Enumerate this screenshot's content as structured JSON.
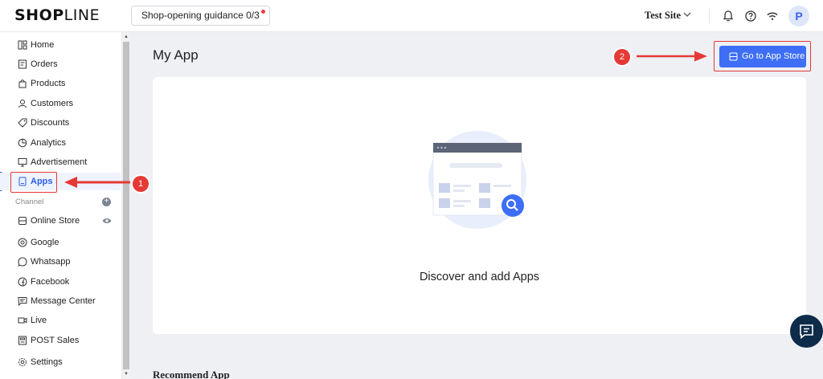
{
  "header": {
    "logo_bold": "SHOP",
    "logo_rest": "LINE",
    "guidance": "Shop-opening guidance 0/3",
    "site_name": "Test Site",
    "avatar_initial": "P"
  },
  "sidebar": {
    "items": [
      {
        "label": "Home",
        "icon": "home-icon"
      },
      {
        "label": "Orders",
        "icon": "orders-icon"
      },
      {
        "label": "Products",
        "icon": "products-icon"
      },
      {
        "label": "Customers",
        "icon": "customers-icon"
      },
      {
        "label": "Discounts",
        "icon": "discount-tag-icon"
      },
      {
        "label": "Analytics",
        "icon": "analytics-icon"
      },
      {
        "label": "Advertisement",
        "icon": "advertisement-icon"
      },
      {
        "label": "Apps",
        "icon": "apps-icon",
        "active": true
      }
    ],
    "channel_label": "Channel",
    "channels": [
      {
        "label": "Online Store",
        "icon": "store-icon"
      },
      {
        "label": "Google",
        "icon": "google-icon"
      },
      {
        "label": "Whatsapp",
        "icon": "whatsapp-icon"
      },
      {
        "label": "Facebook",
        "icon": "facebook-icon"
      },
      {
        "label": "Message Center",
        "icon": "message-icon"
      },
      {
        "label": "Live",
        "icon": "live-icon"
      },
      {
        "label": "POST Sales",
        "icon": "pos-icon"
      }
    ],
    "settings_label": "Settings"
  },
  "main": {
    "title": "My App",
    "store_button": "Go to App Store",
    "empty_text": "Discover and add Apps",
    "recommend_title": "Recommend App"
  },
  "annotations": {
    "step1": "1",
    "step2": "2"
  },
  "colors": {
    "accent": "#3d6ef5",
    "annotation": "#e53935",
    "background": "#eef0f4"
  }
}
